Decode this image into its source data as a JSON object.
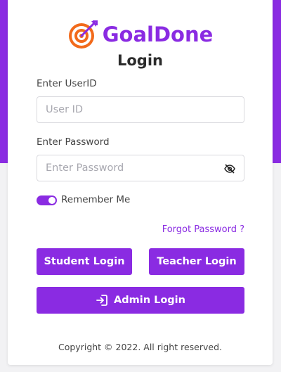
{
  "brand": {
    "name": "GoalDone",
    "primary_color": "#8a2be2",
    "logo_icon": "target-arrow-icon"
  },
  "page": {
    "title": "Login"
  },
  "form": {
    "userid": {
      "label": "Enter UserID",
      "placeholder": "User ID",
      "value": ""
    },
    "password": {
      "label": "Enter Password",
      "placeholder": "Enter Password",
      "value": "",
      "toggle_icon": "eye-slash-icon"
    },
    "remember_me": {
      "label": "Remember Me",
      "checked": true
    },
    "forgot_password": "Forgot Password ?"
  },
  "buttons": {
    "student": "Student Login",
    "teacher": "Teacher Login",
    "admin": {
      "label": "Admin Login",
      "icon": "sign-in-icon"
    }
  },
  "footer": {
    "copyright": "Copyright © 2022. All right reserved."
  }
}
